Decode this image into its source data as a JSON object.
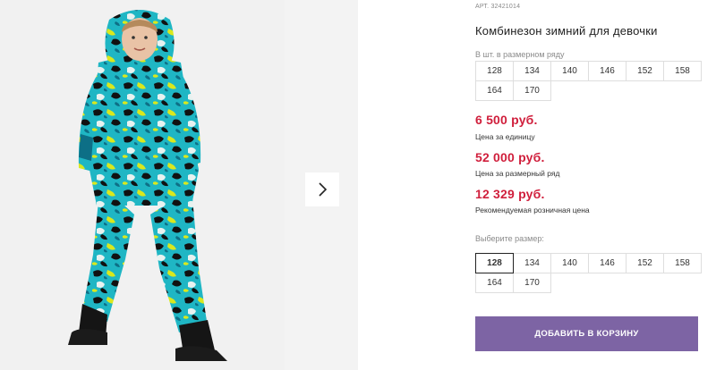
{
  "gallery": {
    "next_icon": "chevron-right-icon"
  },
  "product": {
    "article_prefix": "АРТ.",
    "article": "32421014",
    "title": "Комбинезон зимний для девочки",
    "row_sizes_hint": "В шт. в размерном ряду",
    "row_sizes": [
      "128",
      "134",
      "140",
      "146",
      "152",
      "158",
      "164",
      "170"
    ],
    "prices": [
      {
        "value": "6 500 руб.",
        "caption": "Цена за единицу"
      },
      {
        "value": "52 000 руб.",
        "caption": "Цена за размерный ряд"
      },
      {
        "value": "12 329 руб.",
        "caption": "Рекомендуемая розничная цена"
      }
    ],
    "choose_size_hint": "Выберите размер:",
    "sizes": [
      "128",
      "134",
      "140",
      "146",
      "152",
      "158",
      "164",
      "170"
    ],
    "selected_size": "128",
    "add_to_cart": "ДОБАВИТЬ В КОРЗИНУ",
    "colors": {
      "price": "#d01f3c",
      "button": "#7d64a4"
    }
  }
}
